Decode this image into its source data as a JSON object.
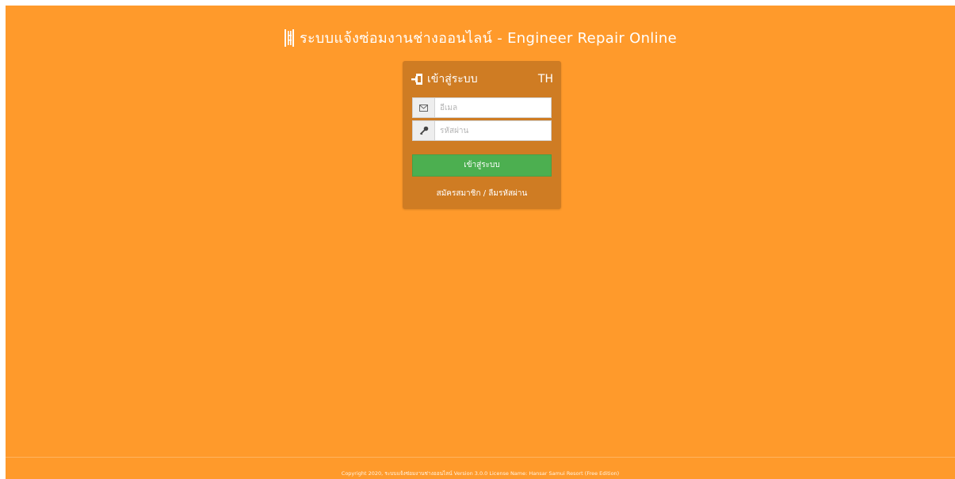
{
  "header": {
    "title": "ระบบแจ้งซ่อมงานช่างออนไลน์ - Engineer Repair Online",
    "logo_icon": "building-logo-icon"
  },
  "login": {
    "heading": "เข้าสู่ระบบ",
    "heading_icon": "sign-in-icon",
    "language": "TH",
    "email": {
      "icon": "envelope-icon",
      "placeholder": "อีเมล",
      "value": ""
    },
    "password": {
      "icon": "key-icon",
      "placeholder": "รหัสผ่าน",
      "value": ""
    },
    "submit_label": "เข้าสู่ระบบ",
    "register_link": "สมัครสมาชิก",
    "link_separator": "/",
    "forgot_link": "ลืมรหัสผ่าน"
  },
  "footer": {
    "text": "Copyright 2020, ระบบแจ้งซ่อมงานช่างออนไลน์ Version 3.0.0 License Name: Hansar Samui Resort (Free Edition)"
  },
  "colors": {
    "background": "#ff9a2b",
    "panel": "#cf7c23",
    "button": "#4caf50"
  }
}
